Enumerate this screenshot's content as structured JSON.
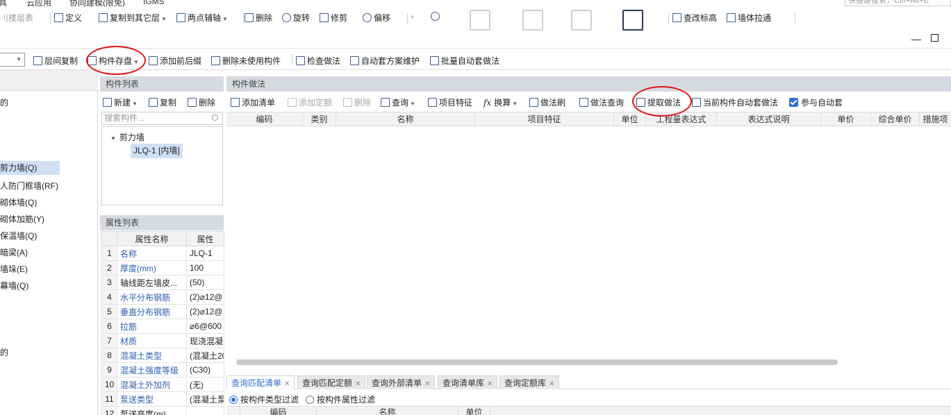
{
  "menubar": {
    "items": [
      "具",
      "云应用",
      "协同建模(限免)",
      "IGMS"
    ],
    "shortcut_placeholder": "快捷键搜索，Ctrl+Alt+E"
  },
  "ribbon": {
    "floor_tab": "刂楼层表",
    "define": "定义",
    "copy_to_floor": "复制到其它层",
    "two_point_axis": "两点辅轴",
    "delete": "删除",
    "rotate": "旋转",
    "trim": "修剪",
    "offset": "偏移",
    "check_elevation": "查改标高",
    "wall_extend": "墙体拉通"
  },
  "toolbar2": {
    "floor_copy": "层间复制",
    "component_save": "构件存盘",
    "add_prefix": "添加前后缀",
    "delete_unused": "删除未使用构件",
    "check_method": "检查做法",
    "auto_scheme": "自动套方案维护",
    "batch_auto": "批量自动套做法"
  },
  "left_panel": {
    "items": [
      {
        "label": "剪力墙(Q)",
        "selected": true
      },
      {
        "label": "人防门框墙(RF)",
        "selected": false
      },
      {
        "label": "砌体墙(Q)",
        "selected": false
      },
      {
        "label": "砌体加筋(Y)",
        "selected": false
      },
      {
        "label": "保温墙(Q)",
        "selected": false
      },
      {
        "label": "暗梁(A)",
        "selected": false
      },
      {
        "label": "墙垛(E)",
        "selected": false
      },
      {
        "label": "幕墙(Q)",
        "selected": false
      }
    ],
    "frag_top": "的",
    "frag_bottom": "的"
  },
  "component_list": {
    "title": "构件列表",
    "new": "新建",
    "copy": "复制",
    "delete": "删除",
    "search_placeholder": "搜索构件...",
    "tree_root": "剪力墙",
    "tree_child": "JLQ-1 [内墙]"
  },
  "property_list": {
    "title": "属性列表",
    "header_name": "属性名称",
    "header_value": "属性",
    "rows": [
      {
        "no": "1",
        "name": "名称",
        "value": "JLQ-1",
        "blue": true
      },
      {
        "no": "2",
        "name": "厚度(mm)",
        "value": "100",
        "blue": true
      },
      {
        "no": "3",
        "name": "轴线距左墙皮...",
        "value": "(50)",
        "blue": false
      },
      {
        "no": "4",
        "name": "水平分布钢筋",
        "value": "(2)⌀12@",
        "blue": true
      },
      {
        "no": "5",
        "name": "垂直分布钢筋",
        "value": "(2)⌀12@",
        "blue": true
      },
      {
        "no": "6",
        "name": "拉筋",
        "value": "⌀6@600",
        "blue": true
      },
      {
        "no": "7",
        "name": "材质",
        "value": "现浇混凝",
        "blue": true
      },
      {
        "no": "8",
        "name": "混凝土类型",
        "value": "(混凝土20",
        "blue": true
      },
      {
        "no": "9",
        "name": "混凝土强度等级",
        "value": "(C30)",
        "blue": true
      },
      {
        "no": "10",
        "name": "混凝土外加剂",
        "value": "(无)",
        "blue": true
      },
      {
        "no": "11",
        "name": "泵送类型",
        "value": "(混凝土泵",
        "blue": true
      },
      {
        "no": "12",
        "name": "泵送高度(m)",
        "value": "",
        "blue": false
      }
    ]
  },
  "method_panel": {
    "title": "构件做法",
    "add_list": "添加清单",
    "add_quota": "添加定额",
    "delete": "删除",
    "query": "查询",
    "item_feature": "项目特征",
    "convert": "换算",
    "method_brush": "做法刷",
    "method_query": "做法查询",
    "extract_method": "提取做法",
    "current_auto": "当前构件自动套做法",
    "join_auto": "参与自动套",
    "columns": [
      "编码",
      "类别",
      "名称",
      "项目特征",
      "单位",
      "工程量表达式",
      "表达式说明",
      "单价",
      "综合单价",
      "措施项"
    ]
  },
  "bottom_panel": {
    "tabs": [
      "查询匹配清单",
      "查询匹配定额",
      "查询外部清单",
      "查询清单库",
      "查询定额库"
    ],
    "filter_type": "按构件类型过滤",
    "filter_attr": "按构件属性过滤",
    "columns": [
      "编码",
      "名称",
      "单位"
    ]
  },
  "colors": {
    "accent": "#2f6fd6",
    "annotation": "#e01515",
    "selection": "#cfe0f5"
  }
}
